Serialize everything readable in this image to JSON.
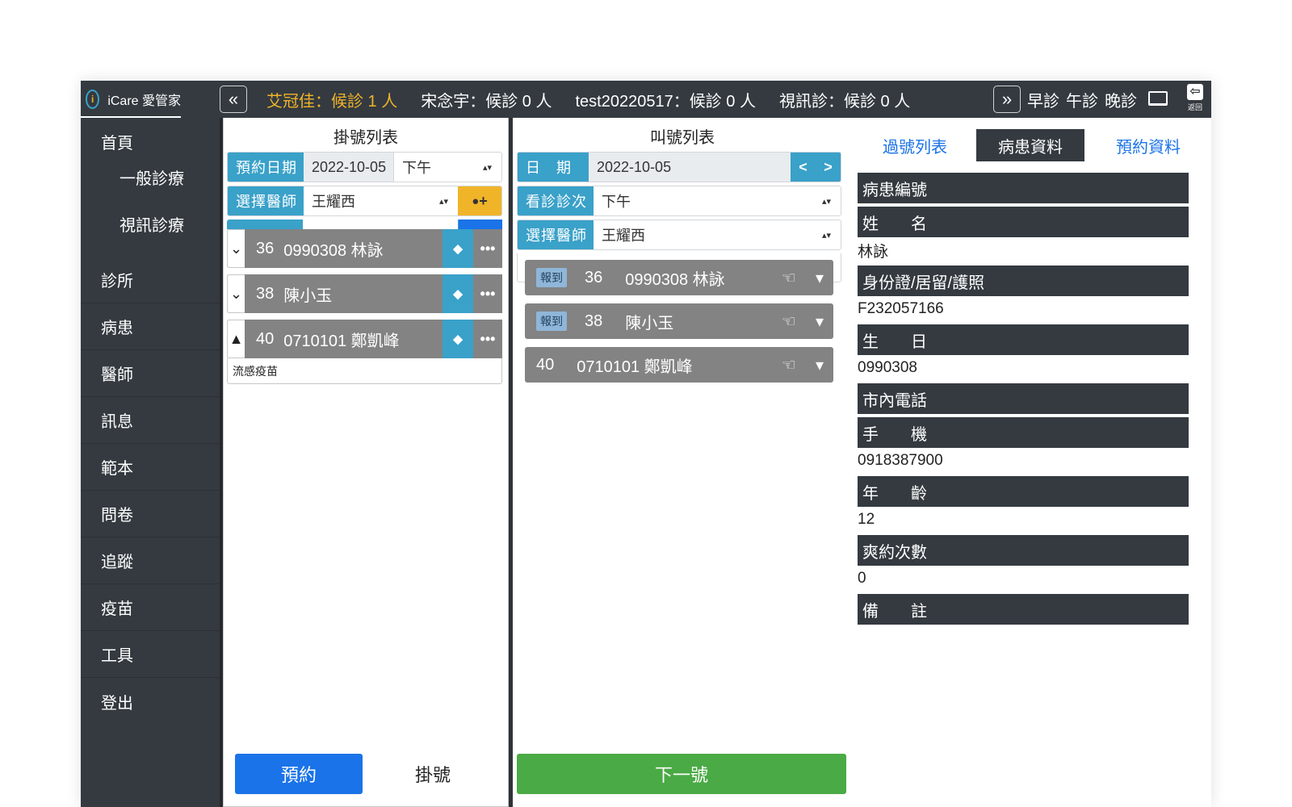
{
  "topbar": {
    "brand": "iCare 愛管家",
    "brand_logo": "i",
    "collapse_glyph": "«",
    "expand_glyph": "»",
    "waiting": [
      "艾冠佳：候診 1 人",
      "宋念宇：候診 0 人",
      "test20220517：候診 0 人",
      "視訊診：候診 0 人"
    ],
    "sessions": [
      "早診",
      "午診",
      "晚診"
    ],
    "back_glyph": "⇦",
    "back_label": "返回"
  },
  "sidebar": {
    "items": [
      "首頁",
      "一般診療",
      "視訊診療",
      "診所",
      "病患",
      "醫師",
      "訊息",
      "範本",
      "問卷",
      "追蹤",
      "疫苗",
      "工具",
      "登出"
    ]
  },
  "registration": {
    "title": "掛號列表",
    "date_label": "預約日期",
    "date_value": "2022-10-05",
    "period_value": "下午",
    "doctor_label": "選擇醫師",
    "doctor_value": "王耀西",
    "add_glyph": "+",
    "entries": [
      {
        "check": "⌄",
        "number": "36",
        "text": "0990308 林詠"
      },
      {
        "check": "⌄",
        "number": "38",
        "text": "陳小玉"
      },
      {
        "check": "▲",
        "number": "40",
        "text": "0710101 鄭凱峰"
      }
    ],
    "note": "流感疫苗",
    "tag_glyph": "⬥",
    "more_glyph": "•••",
    "appointment_button": "預約",
    "register_button": "掛號"
  },
  "calling": {
    "title": "叫號列表",
    "date_label": "日　期",
    "date_value": "2022-10-05",
    "prev_glyph": "<",
    "next_glyph": ">",
    "session_label": "看診診次",
    "session_value": "下午",
    "doctor_label": "選擇醫師",
    "doctor_value": "王耀西",
    "entries": [
      {
        "badge": "報到",
        "number": "36",
        "text": "0990308 林詠"
      },
      {
        "badge": "報到",
        "number": "38",
        "text": "陳小玉"
      },
      {
        "badge": "",
        "number": "40",
        "text": "0710101 鄭凱峰"
      }
    ],
    "hand_glyph": "☜",
    "dropdown_glyph": "▾",
    "next_button": "下一號"
  },
  "patient": {
    "tabs": [
      "過號列表",
      "病患資料",
      "預約資料"
    ],
    "active_tab": "病患資料",
    "fields": [
      {
        "label": "病患編號",
        "value": ""
      },
      {
        "label": "姓　　名",
        "value": "林詠"
      },
      {
        "label": "身份證/居留/護照",
        "value": "F232057166"
      },
      {
        "label": "生　　日",
        "value": "0990308"
      },
      {
        "label": "市內電話",
        "value": ""
      },
      {
        "label": "手　　機",
        "value": "0918387900"
      },
      {
        "label": "年　　齡",
        "value": "12"
      },
      {
        "label": "爽約次數",
        "value": "0"
      },
      {
        "label": "備　　註",
        "value": ""
      }
    ]
  },
  "colors": {
    "dark": "#343a40",
    "accent_blue": "#3aa1c9",
    "primary_blue": "#1a73e8",
    "green": "#4aaa45",
    "gold": "#f0b429",
    "card_grey": "#838383"
  }
}
